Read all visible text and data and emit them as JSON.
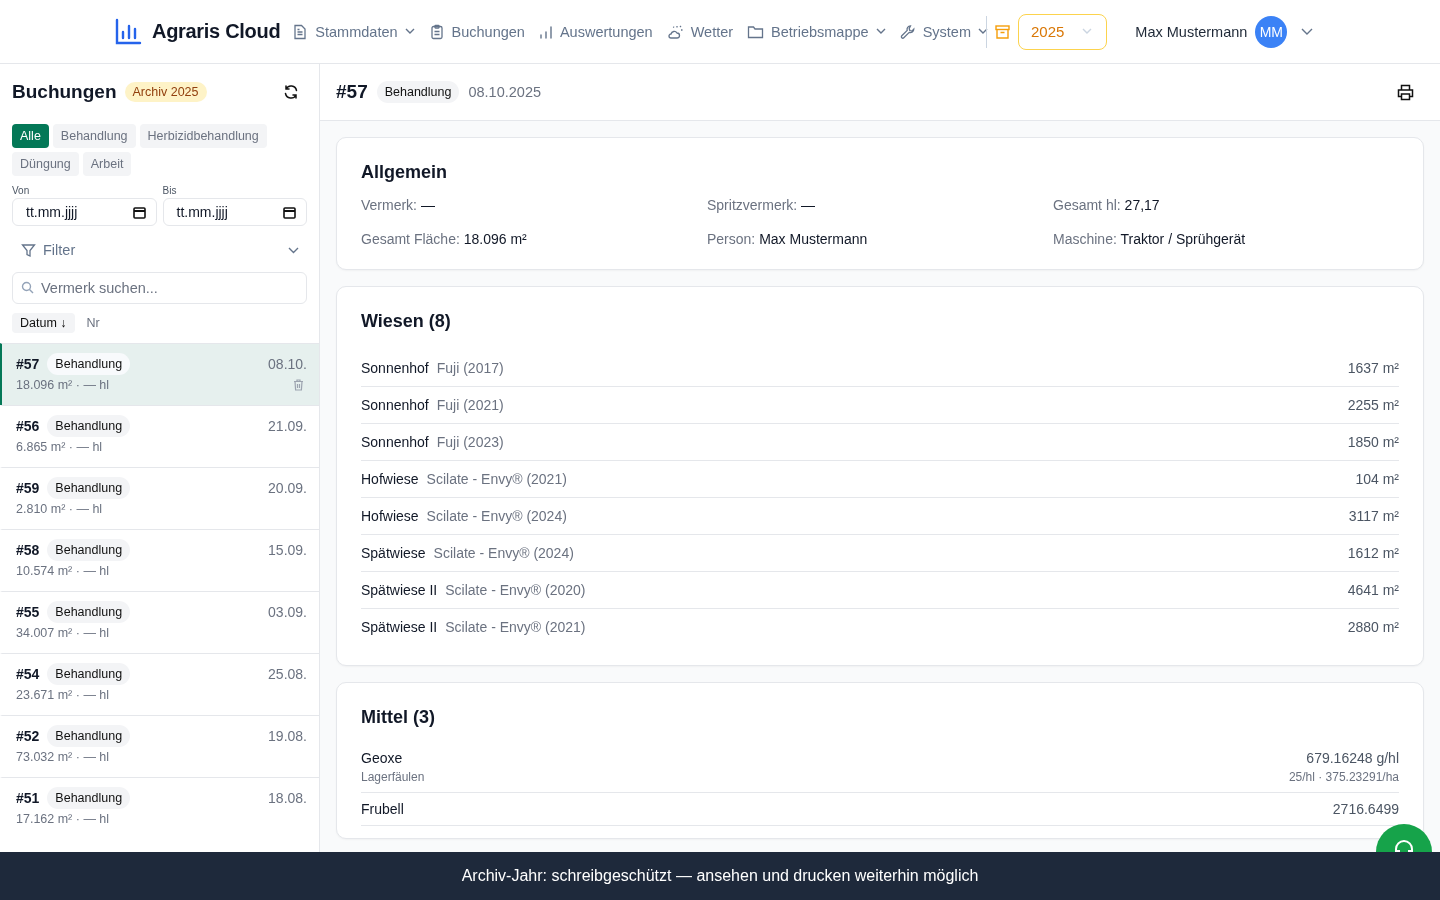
{
  "header": {
    "brand": "Agraris Cloud",
    "nav": [
      {
        "label": "Stammdaten",
        "has_menu": true
      },
      {
        "label": "Buchungen",
        "has_menu": false
      },
      {
        "label": "Auswertungen",
        "has_menu": false
      },
      {
        "label": "Wetter",
        "has_menu": false
      },
      {
        "label": "Betriebsmappe",
        "has_menu": true
      },
      {
        "label": "System",
        "has_menu": true
      }
    ],
    "year": "2025",
    "user": "Max Mustermann",
    "avatar": "MM"
  },
  "sidebar": {
    "title": "Buchungen",
    "badge": "Archiv 2025",
    "types": [
      {
        "label": "Alle",
        "selected": true
      },
      {
        "label": "Behandlung",
        "selected": false
      },
      {
        "label": "Herbizidbehandlung",
        "selected": false
      },
      {
        "label": "Düngung",
        "selected": false
      },
      {
        "label": "Arbeit",
        "selected": false
      }
    ],
    "from": {
      "label": "Von",
      "placeholder": "tt.mm.jjjj"
    },
    "to": {
      "label": "Bis",
      "placeholder": "tt.mm.jjjj"
    },
    "filter": "Filter",
    "search": {
      "placeholder": "Vermerk suchen..."
    },
    "sort": [
      {
        "label": "Datum ↓",
        "selected": true
      },
      {
        "label": "Nr",
        "selected": false
      }
    ],
    "items": [
      {
        "nr": "#57",
        "type": "Behandlung",
        "date": "08.10.",
        "meta": "18.096 m² · — hl",
        "selected": true
      },
      {
        "nr": "#56",
        "type": "Behandlung",
        "date": "21.09.",
        "meta": "6.865 m² · — hl",
        "selected": false
      },
      {
        "nr": "#59",
        "type": "Behandlung",
        "date": "20.09.",
        "meta": "2.810 m² · — hl",
        "selected": false
      },
      {
        "nr": "#58",
        "type": "Behandlung",
        "date": "15.09.",
        "meta": "10.574 m² · — hl",
        "selected": false
      },
      {
        "nr": "#55",
        "type": "Behandlung",
        "date": "03.09.",
        "meta": "34.007 m² · — hl",
        "selected": false
      },
      {
        "nr": "#54",
        "type": "Behandlung",
        "date": "25.08.",
        "meta": "23.671 m² · — hl",
        "selected": false
      },
      {
        "nr": "#52",
        "type": "Behandlung",
        "date": "19.08.",
        "meta": "73.032 m² · — hl",
        "selected": false
      },
      {
        "nr": "#51",
        "type": "Behandlung",
        "date": "18.08.",
        "meta": "17.162 m² · — hl",
        "selected": false
      }
    ]
  },
  "detail": {
    "nr": "#57",
    "type": "Behandlung",
    "date": "08.10.2025",
    "general": {
      "title": "Allgemein",
      "fields": [
        {
          "label": "Vermerk:",
          "value": "—"
        },
        {
          "label": "Spritzvermerk:",
          "value": "—"
        },
        {
          "label": "Gesamt hl:",
          "value": "27,17"
        },
        {
          "label": "Gesamt Fläche:",
          "value": "18.096 m²"
        },
        {
          "label": "Person:",
          "value": "Max Mustermann"
        },
        {
          "label": "Maschine:",
          "value": "Traktor / Sprühgerät"
        }
      ]
    },
    "fields": {
      "title": "Wiesen (8)",
      "rows": [
        {
          "name": "Sonnenhof",
          "variety": "Fuji (2017)",
          "area": "1637 m²"
        },
        {
          "name": "Sonnenhof",
          "variety": "Fuji (2021)",
          "area": "2255 m²"
        },
        {
          "name": "Sonnenhof",
          "variety": "Fuji (2023)",
          "area": "1850 m²"
        },
        {
          "name": "Hofwiese",
          "variety": "Scilate - Envy® (2021)",
          "area": "104 m²"
        },
        {
          "name": "Hofwiese",
          "variety": "Scilate - Envy® (2024)",
          "area": "3117 m²"
        },
        {
          "name": "Spätwiese",
          "variety": "Scilate - Envy® (2024)",
          "area": "1612 m²"
        },
        {
          "name": "Spätwiese II",
          "variety": "Scilate - Envy® (2020)",
          "area": "4641 m²"
        },
        {
          "name": "Spätwiese II",
          "variety": "Scilate - Envy® (2021)",
          "area": "2880 m²"
        }
      ]
    },
    "agents": {
      "title": "Mittel (3)",
      "rows": [
        {
          "name": "Geoxe",
          "note": "Lagerfäulen",
          "amount": "679.16248 g/hl",
          "dose": "25/hl · 375.23291/ha"
        },
        {
          "name": "Frubell",
          "amount": "2716.6499"
        }
      ]
    }
  },
  "banner": "Archiv-Jahr: schreibgeschützt — ansehen und drucken weiterhin möglich"
}
